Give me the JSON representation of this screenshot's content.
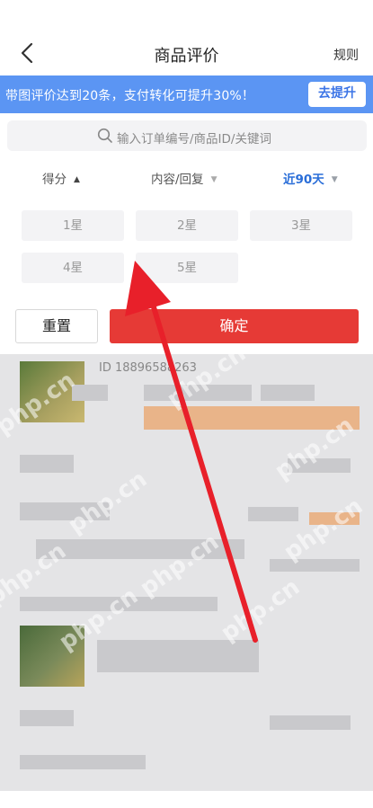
{
  "nav": {
    "title": "商品评价",
    "rules_label": "规则"
  },
  "banner": {
    "text": "带图评价达到20条，支付转化可提升30%！",
    "button_label": "去提升"
  },
  "search": {
    "placeholder": "输入订单编号/商品ID/关键词"
  },
  "filters": [
    {
      "label": "得分",
      "caret": "▲"
    },
    {
      "label": "内容/回复",
      "caret": "▼"
    },
    {
      "label": "近90天",
      "caret": "▼"
    }
  ],
  "stars": [
    "1星",
    "2星",
    "3星",
    "4星",
    "5星"
  ],
  "actions": {
    "reset_label": "重置",
    "confirm_label": "确定"
  },
  "review": {
    "id_text": "ID 18896588263"
  },
  "watermark": "php.cn",
  "colors": {
    "banner": "#5b95f3",
    "confirm": "#e63a36",
    "active_filter": "#2a6ed8",
    "arrow": "#e8202a"
  }
}
